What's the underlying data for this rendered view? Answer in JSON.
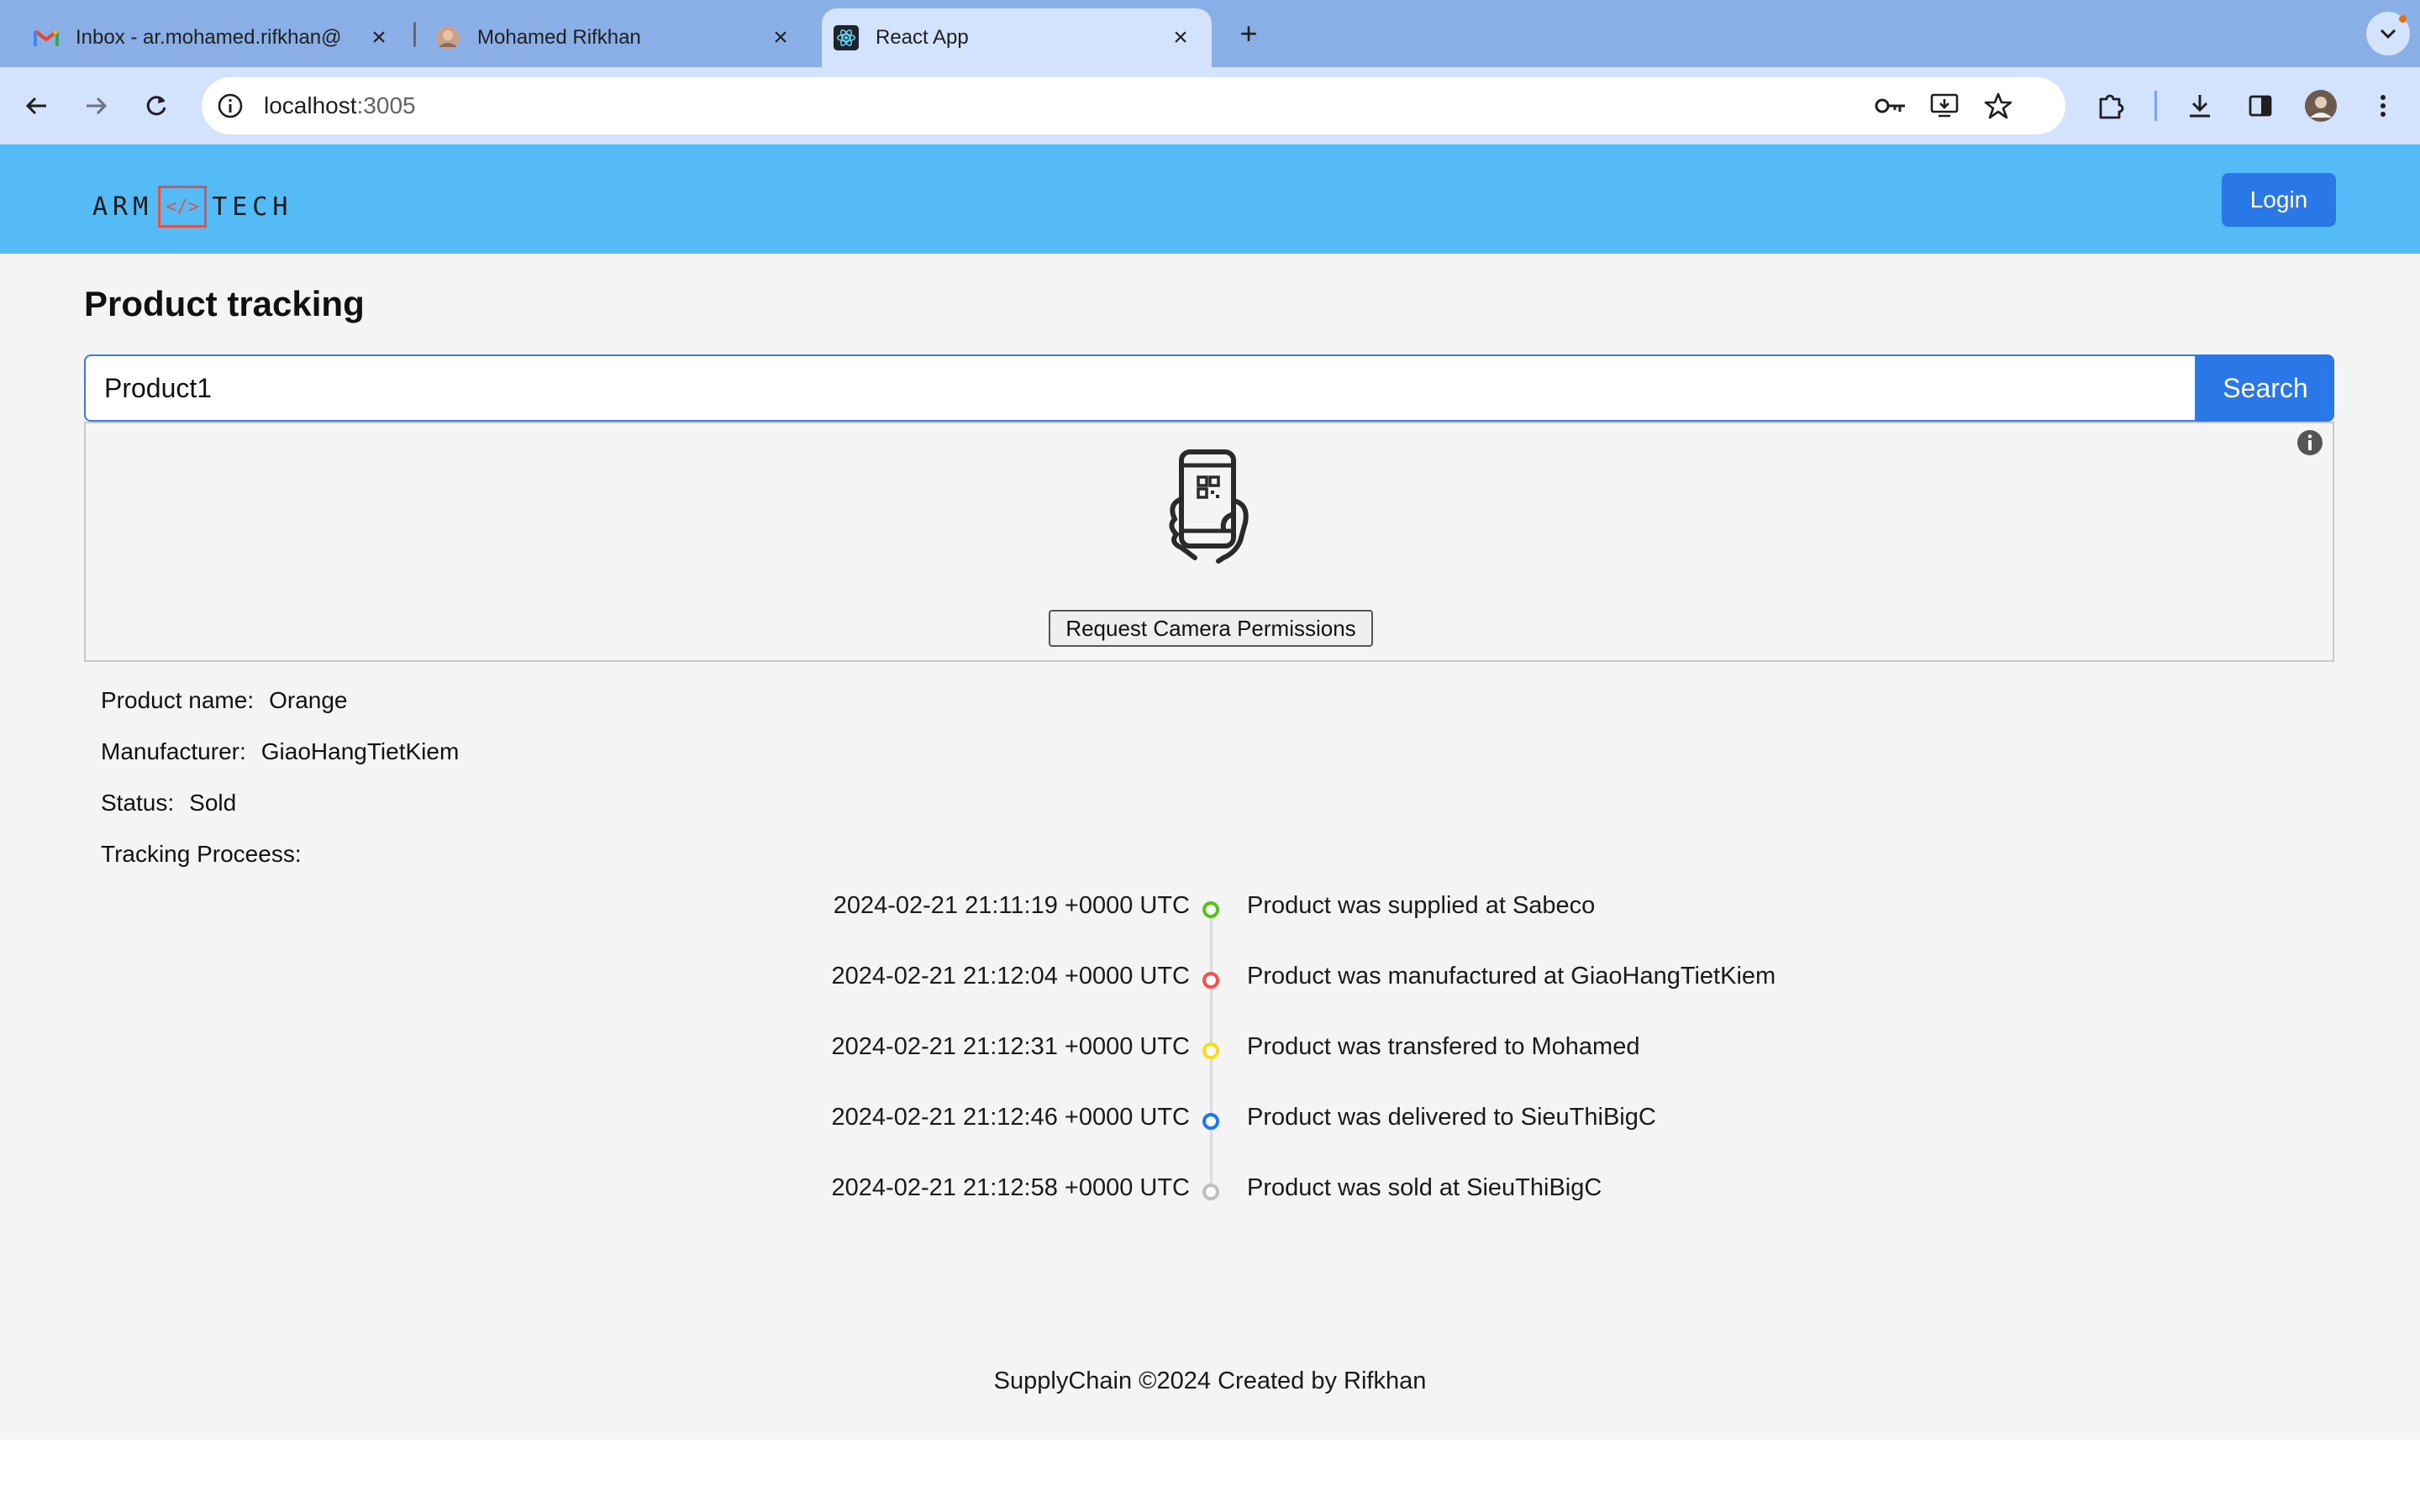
{
  "browser": {
    "tabs": [
      {
        "title": "Inbox - ar.mohamed.rifkhan@",
        "icon": "gmail-icon"
      },
      {
        "title": "Mohamed Rifkhan",
        "icon": "profile-photo-icon"
      },
      {
        "title": "React App",
        "icon": "react-icon",
        "active": true
      }
    ],
    "url_host": "localhost",
    "url_port": ":3005"
  },
  "header": {
    "logo_left": "ARM",
    "logo_code": "</>",
    "logo_right": "TECH",
    "login_label": "Login"
  },
  "tracking": {
    "title": "Product tracking",
    "search_value": "Product1",
    "search_label": "Search",
    "camera_button": "Request Camera Permissions",
    "product_name_label": "Product name:",
    "product_name": "Orange",
    "manufacturer_label": "Manufacturer:",
    "manufacturer": "GiaoHangTietKiem",
    "status_label": "Status:",
    "status": "Sold",
    "process_label": "Tracking Proceess:",
    "events": [
      {
        "time": "2024-02-21 21:11:19 +0000 UTC",
        "text": "Product was supplied at Sabeco",
        "color": "#52c41a"
      },
      {
        "time": "2024-02-21 21:12:04 +0000 UTC",
        "text": "Product was manufactured at GiaoHangTietKiem",
        "color": "#ff4d4f"
      },
      {
        "time": "2024-02-21 21:12:31 +0000 UTC",
        "text": "Product was transfered to Mohamed",
        "color": "#fadb14"
      },
      {
        "time": "2024-02-21 21:12:46 +0000 UTC",
        "text": "Product was delivered to SieuThiBigC",
        "color": "#1677ff"
      },
      {
        "time": "2024-02-21 21:12:58 +0000 UTC",
        "text": "Product was sold at SieuThiBigC",
        "color": "#bfbfbf"
      }
    ]
  },
  "footer": {
    "text": "SupplyChain ©2024 Created by Rifkhan"
  }
}
